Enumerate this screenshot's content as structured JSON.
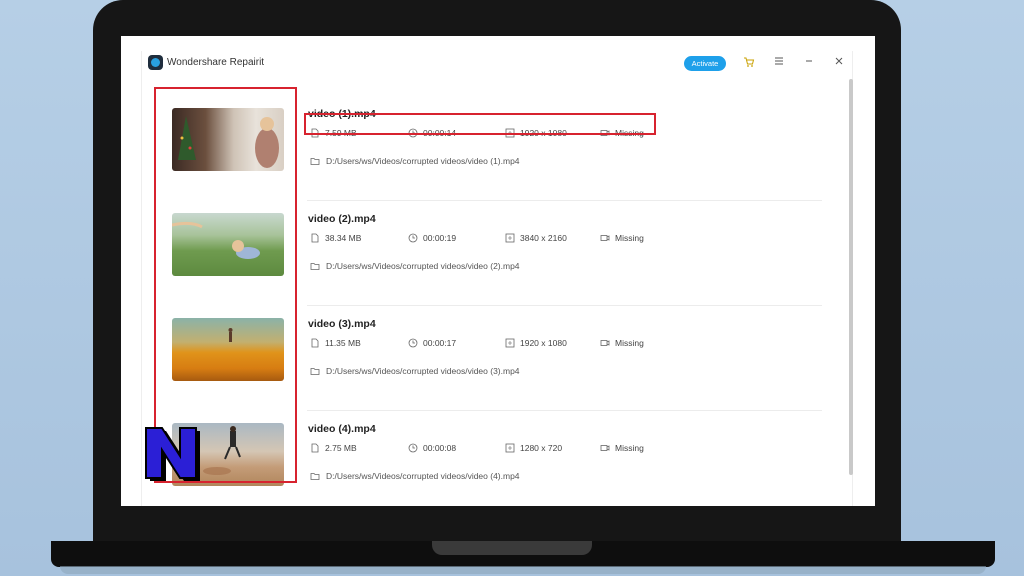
{
  "app": {
    "title": "Wondershare Repairit",
    "activate_label": "Activate",
    "icons": [
      "cart-icon",
      "menu-icon",
      "minimize-icon",
      "close-icon"
    ]
  },
  "videos": [
    {
      "name": "video (1).mp4",
      "size": "7.59  MB",
      "duration": "00:00:14",
      "resolution": "1920 x 1080",
      "audio": "Missing",
      "path": "D:/Users/ws/Videos/corrupted videos/video (1).mp4"
    },
    {
      "name": "video (2).mp4",
      "size": "38.34  MB",
      "duration": "00:00:19",
      "resolution": "3840 x 2160",
      "audio": "Missing",
      "path": "D:/Users/ws/Videos/corrupted videos/video (2).mp4"
    },
    {
      "name": "video (3).mp4",
      "size": "11.35  MB",
      "duration": "00:00:17",
      "resolution": "1920 x 1080",
      "audio": "Missing",
      "path": "D:/Users/ws/Videos/corrupted videos/video (3).mp4"
    },
    {
      "name": "video (4).mp4",
      "size": "2.75  MB",
      "duration": "00:00:08",
      "resolution": "1280 x 720",
      "audio": "Missing",
      "path": "D:/Users/ws/Videos/corrupted videos/video (4).mp4"
    }
  ],
  "colors": {
    "highlight": "#d7232f",
    "activate": "#1ea0ea",
    "logo_fill": "#2b1fd6"
  }
}
